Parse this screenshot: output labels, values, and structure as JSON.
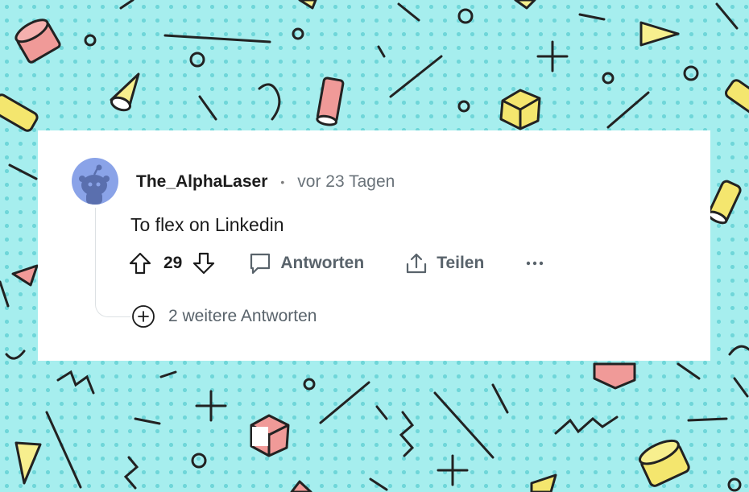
{
  "comment": {
    "username": "The_AlphaLaser",
    "separator": "•",
    "timestamp": "vor 23 Tagen",
    "text": "To flex on Linkedin",
    "vote_count": "29",
    "reply_label": "Antworten",
    "share_label": "Teilen",
    "more_replies_label": "2 weitere Antworten"
  },
  "colors": {
    "background": "#a6eeee",
    "card": "#ffffff",
    "avatar": "#8aa3e8",
    "action_text": "#59636b"
  },
  "icons": [
    "upvote-arrow-icon",
    "downvote-arrow-icon",
    "comment-bubble-icon",
    "share-icon",
    "more-options-icon",
    "plus-circle-icon"
  ]
}
